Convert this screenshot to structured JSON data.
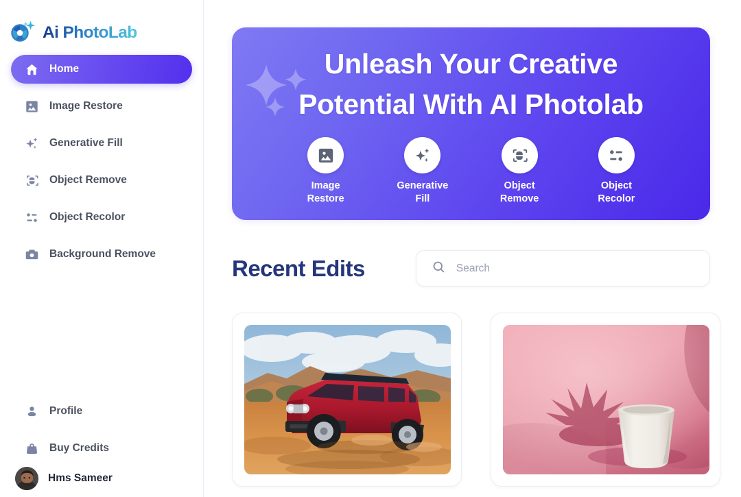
{
  "brand": {
    "name_part1": "Ai ",
    "name_part2": "Photo",
    "name_part3": "Lab",
    "logo_icon": "camera-aperture-sparkle-icon",
    "color_dark": "#1b3a8c",
    "color_mid": "#2f8fd0",
    "color_light": "#4fc3d9"
  },
  "sidebar": {
    "top_items": [
      {
        "label": "Home",
        "icon": "home-icon",
        "active": true
      },
      {
        "label": "Image Restore",
        "icon": "image-icon",
        "active": false
      },
      {
        "label": "Generative Fill",
        "icon": "sparkles-icon",
        "active": false
      },
      {
        "label": "Object Remove",
        "icon": "scan-object-icon",
        "active": false
      },
      {
        "label": "Object Recolor",
        "icon": "sliders-icon",
        "active": false
      },
      {
        "label": "Background Remove",
        "icon": "camera-icon",
        "active": false
      }
    ],
    "bottom_items": [
      {
        "label": "Profile",
        "icon": "user-icon"
      },
      {
        "label": "Buy Credits",
        "icon": "shopping-bag-icon"
      }
    ],
    "user": {
      "name": "Hms Sameer",
      "avatar": "user-avatar-photo"
    }
  },
  "hero": {
    "headline": "Unleash Your Creative Potential With AI Photolab",
    "gradient_from": "#8079f2",
    "gradient_to": "#4a28e9",
    "decor_icon": "sparkles-decoration",
    "actions": [
      {
        "label_line1": "Image",
        "label_line2": "Restore",
        "icon": "image-icon"
      },
      {
        "label_line1": "Generative",
        "label_line2": "Fill",
        "icon": "sparkles-icon"
      },
      {
        "label_line1": "Object",
        "label_line2": "Remove",
        "icon": "scan-object-icon"
      },
      {
        "label_line1": "Object",
        "label_line2": "Recolor",
        "icon": "sliders-icon"
      }
    ]
  },
  "recent": {
    "title": "Recent Edits",
    "title_color": "#24367c",
    "search": {
      "value": "",
      "placeholder": "Search",
      "icon": "search-icon"
    },
    "cards": [
      {
        "alt": "red-suv-in-desert-photo",
        "kind": "vehicle-landscape"
      },
      {
        "alt": "white-pot-with-plant-shadow-on-pink-photo",
        "kind": "pink-still-life"
      }
    ]
  }
}
